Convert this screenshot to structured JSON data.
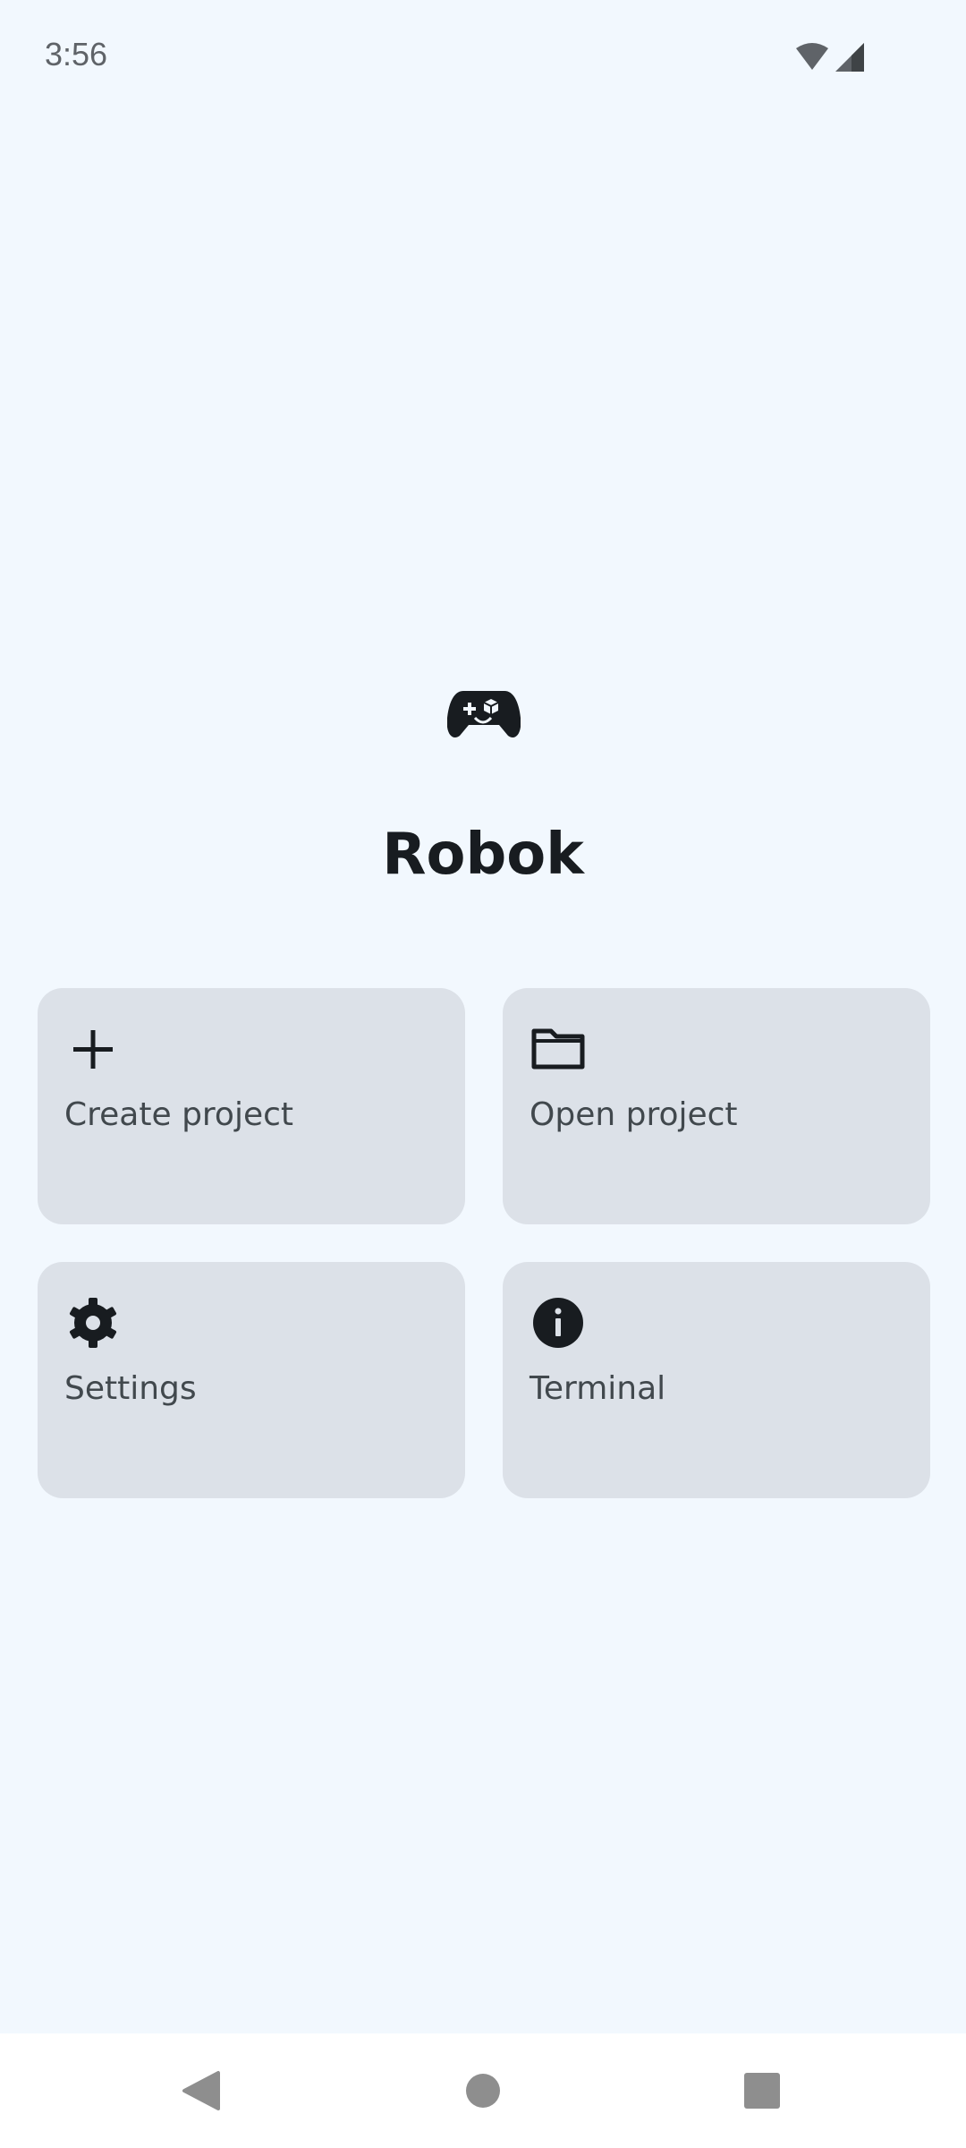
{
  "status_bar": {
    "time": "3:56",
    "icons": [
      "wifi-icon",
      "cellular-signal-icon"
    ]
  },
  "app": {
    "logo_icon": "gamepad-icon",
    "title": "Robok"
  },
  "cards": [
    {
      "label": "Create project",
      "icon": "plus-icon"
    },
    {
      "label": "Open project",
      "icon": "folder-icon"
    },
    {
      "label": "Settings",
      "icon": "gear-icon"
    },
    {
      "label": "Terminal",
      "icon": "info-icon"
    }
  ],
  "nav_bar": {
    "buttons": [
      "back-icon",
      "home-icon",
      "recents-icon"
    ]
  },
  "colors": {
    "background": "#F2F8FE",
    "card": "#DCE1E8",
    "text_primary": "#181C20",
    "text_secondary": "#41484D",
    "icon": "#181C20"
  }
}
